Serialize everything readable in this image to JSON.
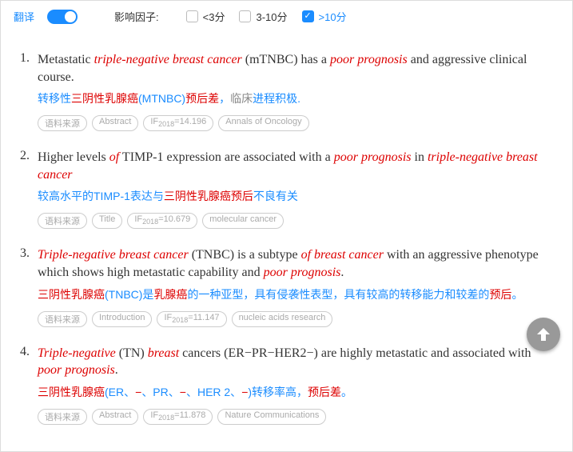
{
  "topbar": {
    "translate_label": "翻译",
    "if_label": "影响因子:",
    "filters": [
      {
        "label": "<3分",
        "checked": false
      },
      {
        "label": "3-10分",
        "checked": false
      },
      {
        "label": ">10分",
        "checked": true
      }
    ]
  },
  "results": [
    {
      "num": "1.",
      "en_parts": [
        {
          "t": "Metastatic ",
          "h": false
        },
        {
          "t": "triple-negative breast cancer",
          "h": true
        },
        {
          "t": " (mTNBC) has a ",
          "h": false
        },
        {
          "t": "poor prognosis",
          "h": true
        },
        {
          "t": " and aggressive clinical course.",
          "h": false
        }
      ],
      "zh_html": "转移性<span class='r'>三阴性乳腺癌</span>(MTNBC)<span class='r'>预后差</span>，<span class='g'>临床</span>进程积极.",
      "tags": [
        "语料来源",
        "Abstract",
        "IF<span class='sub'>2018</span>=14.196",
        "Annals of Oncology"
      ]
    },
    {
      "num": "2.",
      "en_parts": [
        {
          "t": "Higher levels ",
          "h": false
        },
        {
          "t": "of",
          "h": true
        },
        {
          "t": " TIMP-1 expression are associated with a ",
          "h": false
        },
        {
          "t": "poor prognosis",
          "h": true
        },
        {
          "t": " in ",
          "h": false
        },
        {
          "t": "triple-negative breast cancer",
          "h": true
        }
      ],
      "zh_html": "较高水平的TIMP-1表达与<span class='r'>三阴性乳腺癌预后</span>不良有关",
      "tags": [
        "语料来源",
        "Title",
        "IF<span class='sub'>2018</span>=10.679",
        "molecular cancer"
      ]
    },
    {
      "num": "3.",
      "en_parts": [
        {
          "t": "Triple-negative breast cancer",
          "h": true
        },
        {
          "t": " (TNBC) is a subtype ",
          "h": false
        },
        {
          "t": "of breast cancer",
          "h": true
        },
        {
          "t": " with an aggressive phenotype which shows high metastatic capability and ",
          "h": false
        },
        {
          "t": "poor prognosis",
          "h": true
        },
        {
          "t": ".",
          "h": false
        }
      ],
      "zh_html": "<span class='r'>三阴性乳腺癌</span>(TNBC)是<span class='r'>乳腺癌</span>的一种亚型，具有侵袭性表型，具有较高的转移能力和较差的<span class='r'>预后</span>。",
      "tags": [
        "语料来源",
        "Introduction",
        "IF<span class='sub'>2018</span>=11.147",
        "nucleic acids research"
      ]
    },
    {
      "num": "4.",
      "en_parts": [
        {
          "t": "Triple-negative",
          "h": true
        },
        {
          "t": " (TN) ",
          "h": false
        },
        {
          "t": "breast",
          "h": true
        },
        {
          "t": " cancers (ER−PR−HER2−) are highly metastatic and associated with ",
          "h": false
        },
        {
          "t": "poor prognosis",
          "h": true
        },
        {
          "t": ".",
          "h": false
        }
      ],
      "zh_html": "<span class='r'>三阴性乳腺癌</span>(ER、<span class='r'>−</span>、PR、<span class='r'>−</span>、HER 2、<span class='r'>−</span>)转移率高，<span class='r'>预后差</span>。",
      "tags": [
        "语料来源",
        "Abstract",
        "IF<span class='sub'>2018</span>=11.878",
        "Nature Communications"
      ]
    }
  ]
}
